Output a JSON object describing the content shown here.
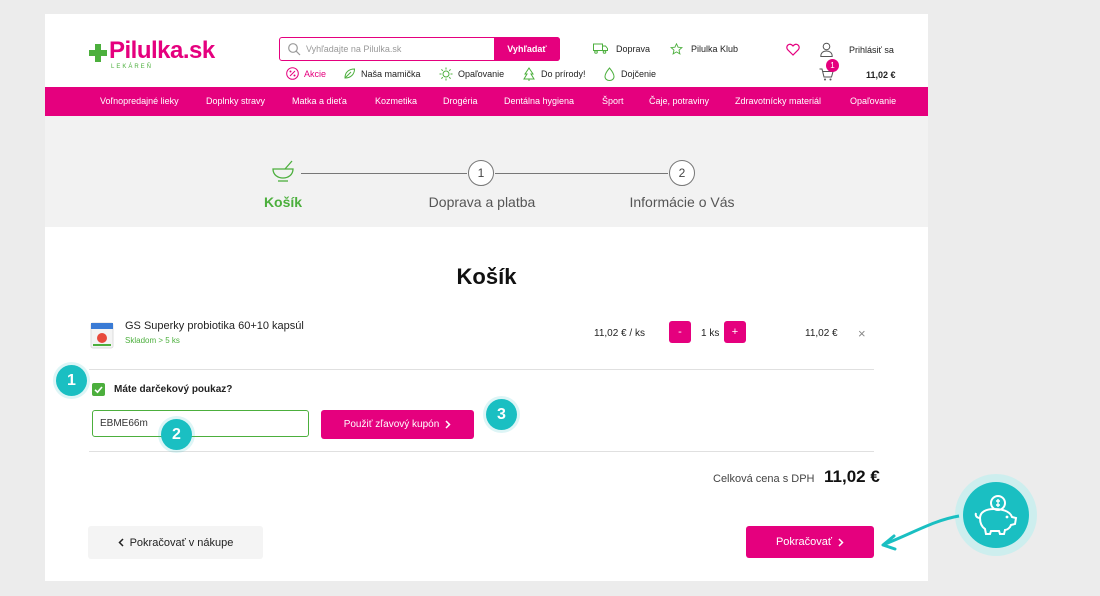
{
  "header": {
    "logo_text": "Pilulka.sk",
    "logo_sub": "LEKÁREŇ",
    "search_placeholder": "Vyhľadajte na Pilulka.sk",
    "search_button": "Vyhľadať",
    "links": {
      "delivery": "Doprava",
      "club": "Pilulka Klub",
      "login": "Prihlásiť sa"
    },
    "promos": [
      "Akcie",
      "Naša mamička",
      "Opaľovanie",
      "Do prírody!",
      "Dojčenie"
    ],
    "cart": {
      "count": "1",
      "total": "11,02 €"
    }
  },
  "nav": {
    "items": [
      "Voľnopredajné lieky",
      "Doplnky stravy",
      "Matka a dieťa",
      "Kozmetika",
      "Drogéria",
      "Dentálna hygiena",
      "Šport",
      "Čaje, potraviny",
      "Zdravotnícky materiál",
      "Opaľovanie"
    ]
  },
  "steps": {
    "items": [
      {
        "label": "Košík",
        "active": true
      },
      {
        "number": "1",
        "label": "Doprava a platba"
      },
      {
        "number": "2",
        "label": "Informácie o Vás"
      }
    ]
  },
  "cart": {
    "title": "Košík",
    "product": {
      "name": "GS Superky probiotika 60+10 kapsúl",
      "stock": "Skladom > 5 ks",
      "unit_price": "11,02 € / ks",
      "minus": "-",
      "plus": "+",
      "quantity": "1 ks",
      "total_price": "11,02 €",
      "remove": "×"
    },
    "voucher": {
      "question": "Máte darčekový poukaz?",
      "checked": true,
      "code_value": "EBME66m",
      "apply_label": "Použiť zľavový kupón"
    },
    "total_label": "Celková cena s DPH",
    "total_value": "11,02 €",
    "back_label": "Pokračovať v nákupe",
    "next_label": "Pokračovať"
  },
  "tutorial": {
    "markers": [
      "1",
      "2",
      "3"
    ],
    "accent_color": "#1abfc2"
  },
  "colors": {
    "brand": "#e5007e",
    "green": "#4caf3d"
  }
}
